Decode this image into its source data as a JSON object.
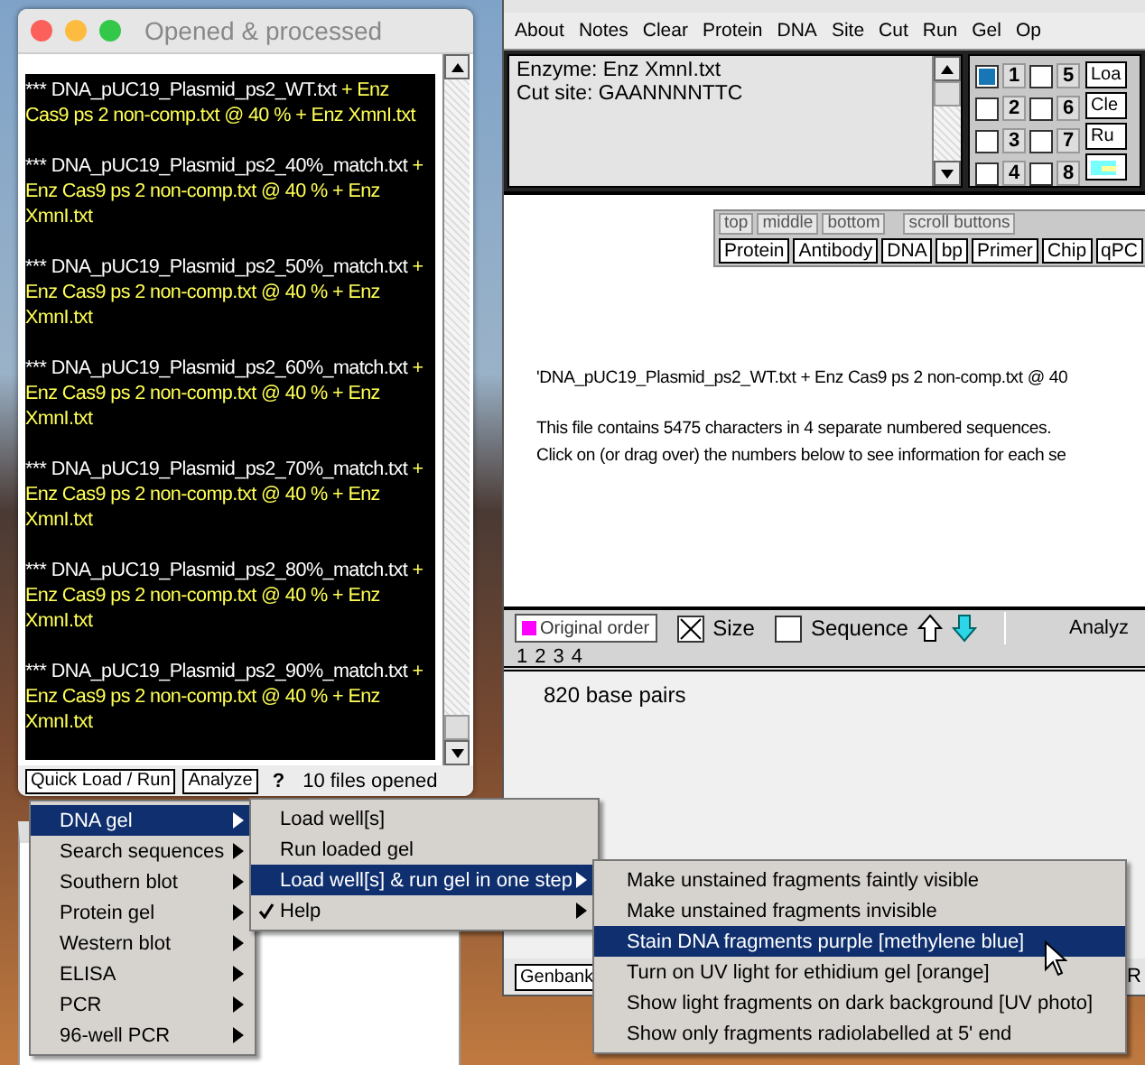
{
  "log_window": {
    "title": "Opened & processed",
    "entries": [
      {
        "file": "*** DNA_pUC19_Plasmid_ps2_WT.txt",
        "detail": "+ Enz Cas9 ps 2 non-comp.txt @ 40 % + Enz XmnI.txt"
      },
      {
        "file": "*** DNA_pUC19_Plasmid_ps2_40%_match.txt",
        "detail": "+ Enz Cas9 ps 2 non-comp.txt @ 40 % + Enz XmnI.txt"
      },
      {
        "file": "*** DNA_pUC19_Plasmid_ps2_50%_match.txt",
        "detail": "+ Enz Cas9 ps 2 non-comp.txt @ 40 % + Enz XmnI.txt"
      },
      {
        "file": "*** DNA_pUC19_Plasmid_ps2_60%_match.txt",
        "detail": "+ Enz Cas9 ps 2 non-comp.txt @ 40 % + Enz XmnI.txt"
      },
      {
        "file": "*** DNA_pUC19_Plasmid_ps2_70%_match.txt",
        "detail": "+ Enz Cas9 ps 2 non-comp.txt @ 40 % + Enz XmnI.txt"
      },
      {
        "file": "*** DNA_pUC19_Plasmid_ps2_80%_match.txt",
        "detail": "+ Enz Cas9 ps 2 non-comp.txt @ 40 % + Enz XmnI.txt"
      },
      {
        "file": "*** DNA_pUC19_Plasmid_ps2_90%_match.txt",
        "detail": "+ Enz Cas9 ps 2 non-comp.txt @ 40 % + Enz XmnI.txt"
      }
    ],
    "buttons": [
      "Quick Load / Run",
      "Analyze"
    ],
    "help": "?",
    "status": "10 files opened"
  },
  "main_window": {
    "menu": [
      "About",
      "Notes",
      "Clear",
      "Protein",
      "DNA",
      "Site",
      "Cut",
      "Run",
      "Gel",
      "Op"
    ],
    "enzyme_info": [
      "Enzyme: Enz XmnI.txt",
      "Cut site: GAANNNNTTC"
    ],
    "lanes": [
      {
        "label": "1",
        "checked": true
      },
      {
        "label": "2",
        "checked": false
      },
      {
        "label": "3",
        "checked": false
      },
      {
        "label": "4",
        "checked": false
      },
      {
        "label": "5",
        "checked": false
      },
      {
        "label": "6",
        "checked": false
      },
      {
        "label": "7",
        "checked": false
      },
      {
        "label": "8",
        "checked": false
      }
    ],
    "side_buttons": [
      "Loa",
      "Cle",
      "Ru"
    ],
    "toolbar_tabs": [
      "top",
      "middle",
      "bottom",
      "scroll buttons"
    ],
    "toolbar_buttons": [
      "Protein",
      "Antibody",
      "DNA",
      "bp",
      "Primer",
      "Chip",
      "qPC"
    ],
    "description": [
      "'DNA_pUC19_Plasmid_ps2_WT.txt + Enz Cas9 ps 2 non-comp.txt @ 40",
      "This file contains 5475 characters in 4 separate numbered sequences.",
      "Click on (or drag over) the numbers below to see information for each se"
    ],
    "sort_button": "Original order",
    "sort_options": [
      {
        "label": "Size",
        "checked": true
      },
      {
        "label": "Sequence",
        "checked": false
      }
    ],
    "analyze_label": "Analyz",
    "sequence_numbers": [
      "1",
      "2",
      "3",
      "4"
    ],
    "sequence_info": "820 base pairs",
    "bottom_buttons": [
      "Genbank"
    ],
    "bottom_right_text": "R"
  },
  "menus": [
    [
      {
        "label": "DNA gel",
        "selected": true,
        "submenu": true,
        "checked": false
      },
      {
        "label": "Search sequences",
        "selected": false,
        "submenu": true,
        "checked": false
      },
      {
        "label": "Southern blot",
        "selected": false,
        "submenu": true,
        "checked": false
      },
      {
        "label": "Protein gel",
        "selected": false,
        "submenu": true,
        "checked": false
      },
      {
        "label": "Western blot",
        "selected": false,
        "submenu": true,
        "checked": false
      },
      {
        "label": "ELISA",
        "selected": false,
        "submenu": true,
        "checked": false
      },
      {
        "label": "PCR",
        "selected": false,
        "submenu": true,
        "checked": false
      },
      {
        "label": "96-well PCR",
        "selected": false,
        "submenu": true,
        "checked": false
      }
    ],
    [
      {
        "label": "Load  well[s]",
        "selected": false,
        "submenu": false,
        "checked": false
      },
      {
        "label": "Run loaded gel",
        "selected": false,
        "submenu": false,
        "checked": false
      },
      {
        "label": "Load well[s] & run gel in one step",
        "selected": true,
        "submenu": true,
        "checked": false
      },
      {
        "label": "Help",
        "selected": false,
        "submenu": true,
        "checked": true
      }
    ],
    [
      {
        "label": "Make unstained fragments faintly visible",
        "selected": false,
        "submenu": false,
        "checked": false
      },
      {
        "label": "Make unstained fragments invisible",
        "selected": false,
        "submenu": false,
        "checked": false
      },
      {
        "label": "Stain DNA fragments purple [methylene blue]",
        "selected": true,
        "submenu": false,
        "checked": false
      },
      {
        "label": "Turn on UV light for ethidium gel [orange]",
        "selected": false,
        "submenu": false,
        "checked": false
      },
      {
        "label": "Show light fragments on dark background  [UV photo]",
        "selected": false,
        "submenu": false,
        "checked": false
      },
      {
        "label": "Show only fragments radiolabelled at 5' end",
        "selected": false,
        "submenu": false,
        "checked": false
      }
    ]
  ]
}
